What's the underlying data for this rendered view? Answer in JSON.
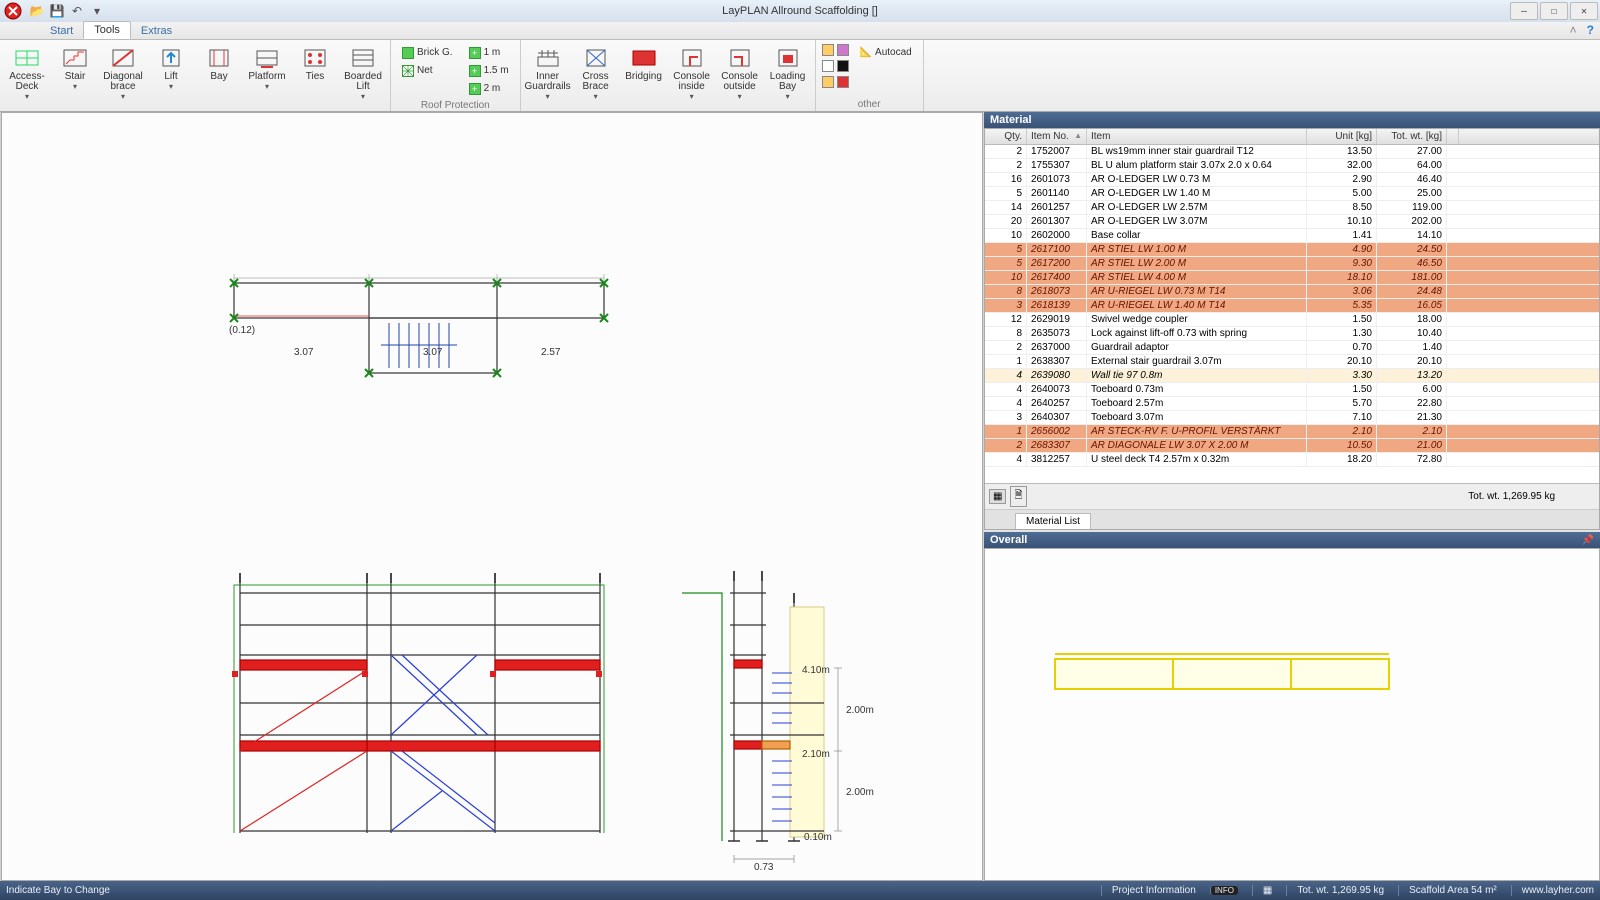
{
  "titlebar": {
    "title": "LayPLAN Allround Scaffolding   []"
  },
  "tabs": {
    "start": "Start",
    "tools": "Tools",
    "extras": "Extras"
  },
  "ribbon": {
    "access_deck": "Access-Deck",
    "stair": "Stair",
    "diagonal_brace": "Diagonal brace",
    "lift": "Lift",
    "bay": "Bay",
    "platform": "Platform",
    "ties": "Ties",
    "boarded_lift": "Boarded Lift",
    "brickg": "Brick G.",
    "net": "Net",
    "m1": "1 m",
    "m15": "1.5 m",
    "m2": "2 m",
    "inner_guardrails": "Inner Guardrails",
    "cross_brace": "Cross Brace",
    "bridging": "Bridging",
    "console_inside": "Console inside",
    "console_outside": "Console outside",
    "loading_bay": "Loading Bay",
    "autocad": "Autocad",
    "group_roof": "Roof Protection",
    "group_other": "other"
  },
  "material": {
    "title": "Material",
    "headers": {
      "qty": "Qty.",
      "itemno": "Item No.",
      "item": "Item",
      "unit": "Unit [kg]",
      "tot": "Tot. wt. [kg]"
    },
    "rows": [
      {
        "q": "2",
        "no": "1752007",
        "it": "BL ws19mm inner stair guardrail T12",
        "u": "13.50",
        "t": "27.00",
        "hl": 0
      },
      {
        "q": "2",
        "no": "1755307",
        "it": "BL U alum platform stair 3.07x 2.0 x 0.64",
        "u": "32.00",
        "t": "64.00",
        "hl": 0
      },
      {
        "q": "16",
        "no": "2601073",
        "it": "AR O-LEDGER LW 0.73 M",
        "u": "2.90",
        "t": "46.40",
        "hl": 0
      },
      {
        "q": "5",
        "no": "2601140",
        "it": "AR O-LEDGER LW 1.40 M",
        "u": "5.00",
        "t": "25.00",
        "hl": 0
      },
      {
        "q": "14",
        "no": "2601257",
        "it": "AR O-LEDGER LW 2.57M",
        "u": "8.50",
        "t": "119.00",
        "hl": 0
      },
      {
        "q": "20",
        "no": "2601307",
        "it": "AR O-LEDGER LW 3.07M",
        "u": "10.10",
        "t": "202.00",
        "hl": 0
      },
      {
        "q": "10",
        "no": "2602000",
        "it": "Base collar",
        "u": "1.41",
        "t": "14.10",
        "hl": 0
      },
      {
        "q": "5",
        "no": "2617100",
        "it": "AR STIEL LW 1.00 M",
        "u": "4.90",
        "t": "24.50",
        "hl": 1
      },
      {
        "q": "5",
        "no": "2617200",
        "it": "AR STIEL LW 2.00 M",
        "u": "9.30",
        "t": "46.50",
        "hl": 1
      },
      {
        "q": "10",
        "no": "2617400",
        "it": "AR STIEL LW 4.00 M",
        "u": "18.10",
        "t": "181.00",
        "hl": 1
      },
      {
        "q": "8",
        "no": "2618073",
        "it": "AR U-RIEGEL LW 0.73 M T14",
        "u": "3.06",
        "t": "24.48",
        "hl": 1
      },
      {
        "q": "3",
        "no": "2618139",
        "it": "AR U-RIEGEL LW 1.40 M T14",
        "u": "5.35",
        "t": "16.05",
        "hl": 1
      },
      {
        "q": "12",
        "no": "2629019",
        "it": "Swivel wedge coupler",
        "u": "1.50",
        "t": "18.00",
        "hl": 0
      },
      {
        "q": "8",
        "no": "2635073",
        "it": "Lock against lift-off 0.73 with spring",
        "u": "1.30",
        "t": "10.40",
        "hl": 0
      },
      {
        "q": "2",
        "no": "2637000",
        "it": "Guardrail adaptor",
        "u": "0.70",
        "t": "1.40",
        "hl": 0
      },
      {
        "q": "1",
        "no": "2638307",
        "it": "External stair guardrail 3.07m",
        "u": "20.10",
        "t": "20.10",
        "hl": 0
      },
      {
        "q": "4",
        "no": "2639080",
        "it": "Wall tie 97 0.8m",
        "u": "3.30",
        "t": "13.20",
        "hl": 2
      },
      {
        "q": "4",
        "no": "2640073",
        "it": "Toeboard 0.73m",
        "u": "1.50",
        "t": "6.00",
        "hl": 0
      },
      {
        "q": "4",
        "no": "2640257",
        "it": "Toeboard 2.57m",
        "u": "5.70",
        "t": "22.80",
        "hl": 0
      },
      {
        "q": "3",
        "no": "2640307",
        "it": "Toeboard 3.07m",
        "u": "7.10",
        "t": "21.30",
        "hl": 0
      },
      {
        "q": "1",
        "no": "2656002",
        "it": "AR STECK-RV F. U-PROFIL VERSTÄRKT",
        "u": "2.10",
        "t": "2.10",
        "hl": 1
      },
      {
        "q": "2",
        "no": "2683307",
        "it": "AR DIAGONALE LW 3.07 X 2.00 M",
        "u": "10.50",
        "t": "21.00",
        "hl": 1
      },
      {
        "q": "4",
        "no": "3812257",
        "it": "U steel deck T4 2.57m x 0.32m",
        "u": "18.20",
        "t": "72.80",
        "hl": 0
      }
    ],
    "total": "Tot. wt. 1,269.95 kg",
    "tab": "Material List"
  },
  "overall": {
    "title": "Overall"
  },
  "canvas": {
    "d_012": "(0.12)",
    "d_307a": "3.07",
    "d_307b": "3.07",
    "d_257": "2.57",
    "d_200a": "2.00m",
    "d_200b": "2.00m",
    "d_010": "0.10m",
    "d_073": "0.73",
    "d_410": "4.10m",
    "d_210": "2.10m"
  },
  "status": {
    "left": "Indicate Bay to Change",
    "proj": "Project Information",
    "tot": "Tot. wt. 1,269.95 kg",
    "area": "Scaffold Area 54 m²",
    "url": "www.layher.com"
  }
}
